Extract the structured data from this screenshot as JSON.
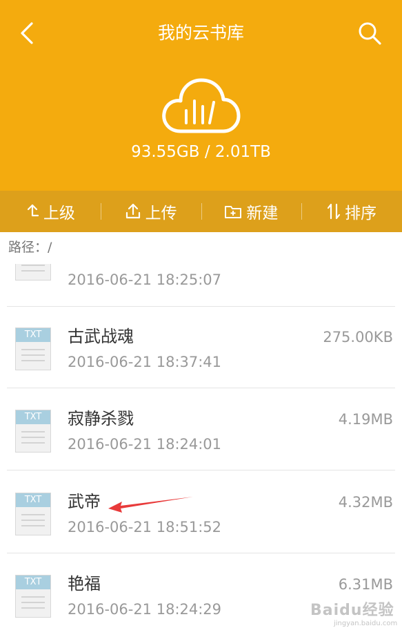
{
  "header": {
    "title": "我的云书库",
    "storage": "93.55GB / 2.01TB",
    "color": "#f4ab0e"
  },
  "toolbar": {
    "color": "#dda01b",
    "up_label": "上级",
    "upload_label": "上传",
    "new_label": "新建",
    "sort_label": "排序"
  },
  "path_label": "路径：/",
  "files": [
    {
      "name": "",
      "date": "2016-06-21 18:25:07",
      "size": "",
      "type": "TXT"
    },
    {
      "name": "古武战魂",
      "date": "2016-06-21 18:37:41",
      "size": "275.00KB",
      "type": "TXT"
    },
    {
      "name": "寂静杀戮",
      "date": "2016-06-21 18:24:01",
      "size": "4.19MB",
      "type": "TXT"
    },
    {
      "name": "武帝",
      "date": "2016-06-21 18:51:52",
      "size": "4.32MB",
      "type": "TXT"
    },
    {
      "name": "艳福",
      "date": "2016-06-21 18:24:29",
      "size": "6.31MB",
      "type": "TXT"
    }
  ],
  "watermark": {
    "brand": "Baidu经验",
    "url": "jingyan.baidu.com"
  },
  "annotation_color": "#e83a3a"
}
